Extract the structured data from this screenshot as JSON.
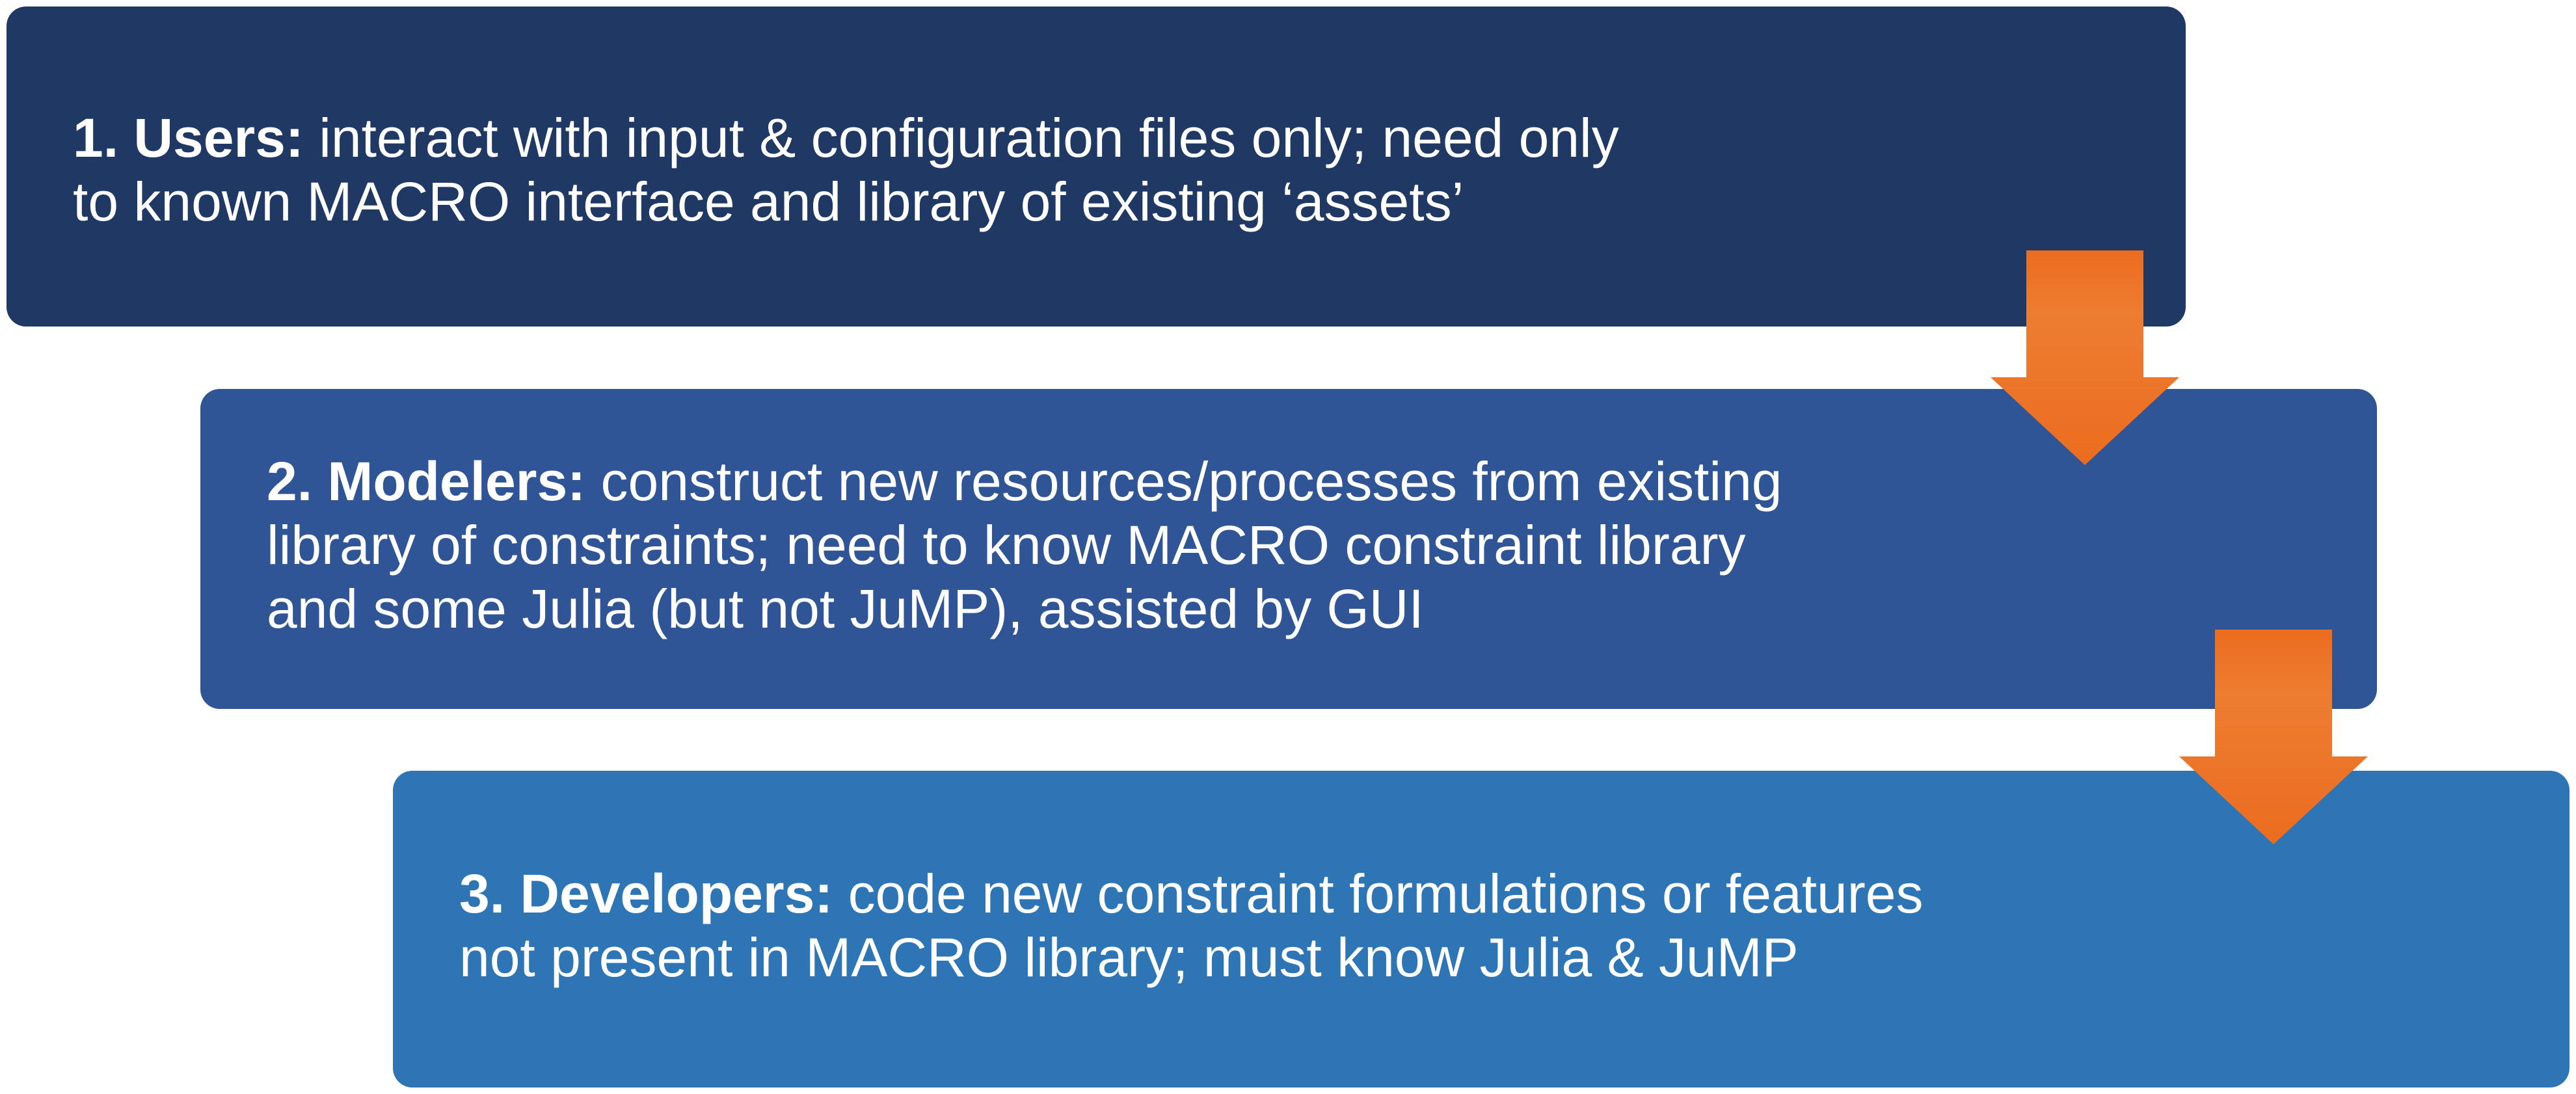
{
  "levels": [
    {
      "title": "1. Users:",
      "line1": " interact with input & configuration files only; need only",
      "line2": "to known MACRO interface and library of existing ‘assets’",
      "color": "#203864"
    },
    {
      "title": "2. Modelers:",
      "line1": " construct new resources/processes from existing",
      "line2": "library of constraints; need to know MACRO constraint library",
      "line3": "and some Julia (but not JuMP), assisted by GUI",
      "color": "#2f5597"
    },
    {
      "title": "3. Developers:",
      "line1": " code new constraint formulations or features",
      "line2": "not present in MACRO library; must know Julia & JuMP",
      "color": "#2e75b6"
    }
  ],
  "arrow_color": "#ec6c1f",
  "arrow_icon": "down-arrow-icon"
}
